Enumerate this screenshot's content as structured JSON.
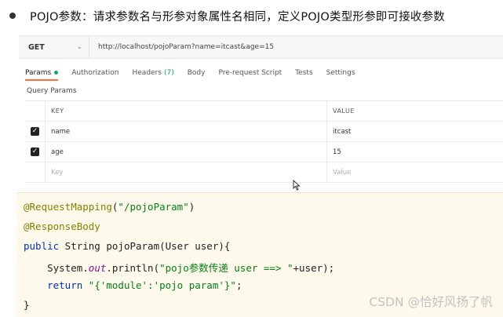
{
  "heading": "POJO参数：请求参数名与形参对象属性名相同，定义POJO类型形参即可接收参数",
  "request": {
    "method": "GET",
    "url": "http://localhost/pojoParam?name=itcast&age=15"
  },
  "tabs": [
    {
      "label": "Params"
    },
    {
      "label": "Authorization"
    },
    {
      "label": "Headers",
      "count": "(7)"
    },
    {
      "label": "Body"
    },
    {
      "label": "Pre-request Script"
    },
    {
      "label": "Tests"
    },
    {
      "label": "Settings"
    }
  ],
  "query_params": {
    "title": "Query Params",
    "headers": {
      "key": "KEY",
      "value": "VALUE"
    },
    "rows": [
      {
        "key": "name",
        "value": "itcast",
        "checked": true
      },
      {
        "key": "age",
        "value": "15",
        "checked": true
      }
    ],
    "placeholder": {
      "key": "Key",
      "value": "Value"
    }
  },
  "code": {
    "l1_ann": "@RequestMapping",
    "l1_open": "(",
    "l1_str": "\"/pojoParam\"",
    "l1_close": ")",
    "l2": "@ResponseBody",
    "l3_kw": "public",
    "l3_rest": " String pojoParam(User user){",
    "l4_a": "    System.",
    "l4_out": "out",
    "l4_b": ".println(",
    "l4_str": "\"pojo参数传递 user ==> \"",
    "l4_c": "+user);",
    "l5_kw": "    return",
    "l5_sp": " ",
    "l5_str": "\"{'module':'pojo param'}\"",
    "l5_end": ";",
    "l6": "}"
  },
  "watermark": "CSDN @恰好风扬了帆"
}
